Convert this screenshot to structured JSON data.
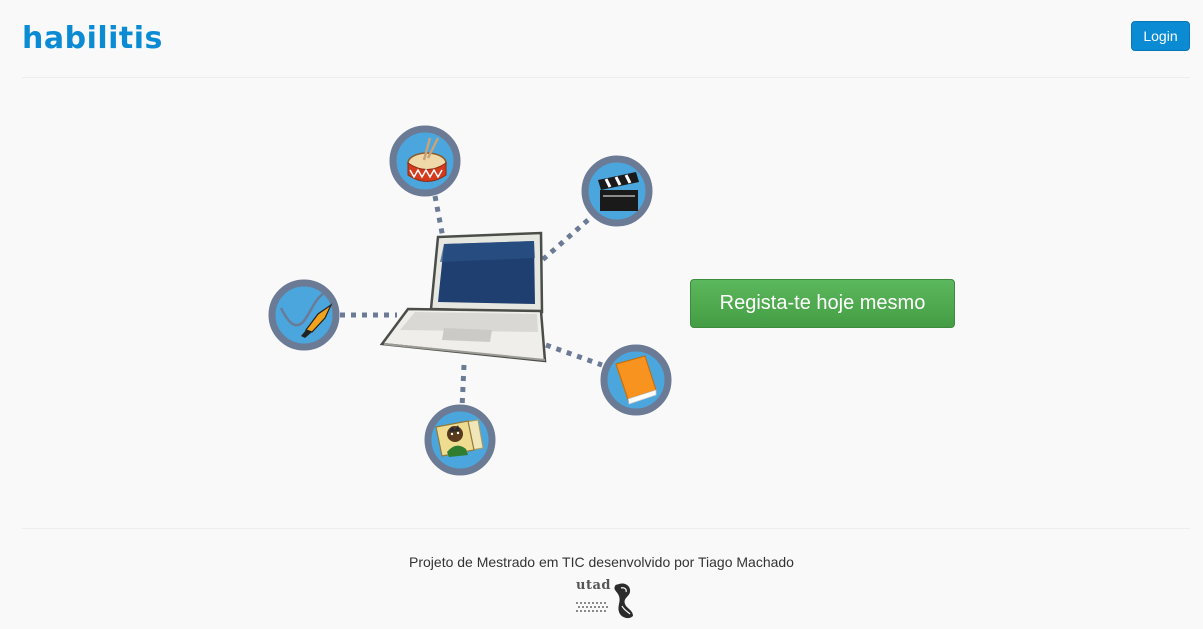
{
  "header": {
    "brand": "habilitis",
    "login_label": "Login"
  },
  "hero": {
    "register_label": "Regista-te hoje mesmo",
    "icons": [
      "laptop-icon",
      "drum-icon",
      "clapperboard-icon",
      "brush-icon",
      "book-icon",
      "photo-icon"
    ]
  },
  "footer": {
    "credit": "Projeto de Mestrado em TIC desenvolvido por Tiago Machado",
    "logo_text": "utad"
  },
  "colors": {
    "brand": "#0a8bd3",
    "login_bg": "#0a8bd3",
    "register_bg": "#5cb85c",
    "icon_ring": "#6b7b96",
    "icon_fill": "#4aa6dc",
    "connector": "#6b7b96",
    "background": "#f9f9f9"
  }
}
